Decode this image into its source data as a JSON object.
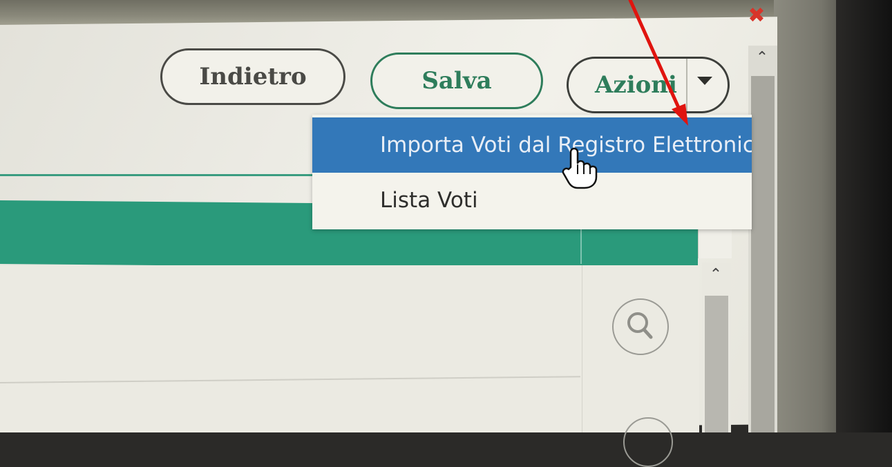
{
  "window": {
    "close_icon": "close-icon"
  },
  "toolbar": {
    "back_label": "Indietro",
    "save_label": "Salva",
    "actions_label": "Azioni"
  },
  "actions_menu": {
    "items": [
      {
        "label": "Importa Voti dal Registro Elettronico",
        "highlighted": true
      },
      {
        "label": "Lista Voti",
        "highlighted": false
      }
    ]
  },
  "table": {
    "row_action_icon": "search-icon"
  },
  "colors": {
    "accent_green": "#2e7d5b",
    "table_header": "#2a9a7b",
    "menu_highlight": "#3378b9",
    "annotation_arrow": "#e0140f",
    "close_icon": "#d8342a"
  }
}
